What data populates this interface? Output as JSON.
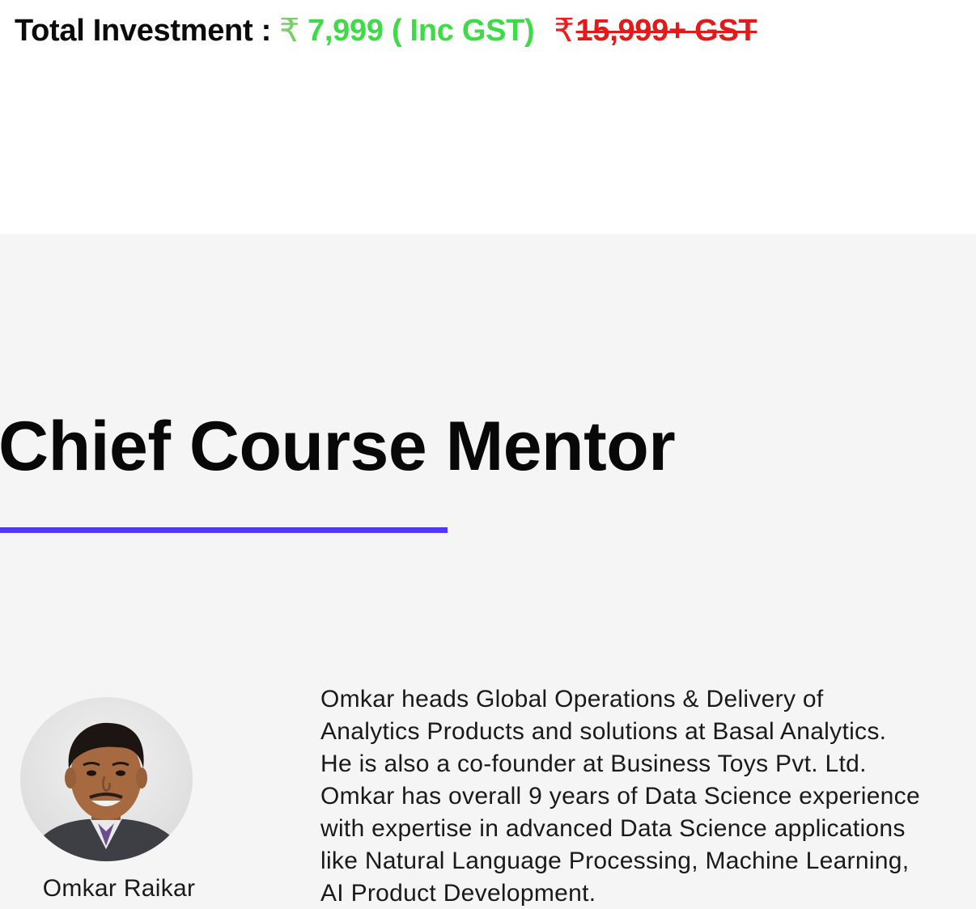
{
  "pricing": {
    "label": "Total Investment :",
    "currency_symbol": "₹",
    "current_price": "7,999 ( Inc GST)",
    "original_price": "15,999+ GST",
    "colors": {
      "label": "#0b0b0b",
      "current": "#3ddc47",
      "original": "#e21a1a"
    }
  },
  "mentor_section": {
    "heading": "Chief Course Mentor",
    "accent_color": "#4f39f6",
    "mentor": {
      "name": "Omkar Raikar",
      "photo_icon": "mentor-photo",
      "bio_lines": [
        "Omkar heads Global Operations & Delivery of",
        "Analytics Products and solutions at Basal Analytics.",
        "He is also a co-founder at Business Toys Pvt. Ltd.",
        "Omkar has overall 9 years of Data Science experience",
        "with expertise in advanced Data Science applications",
        "like Natural Language Processing, Machine Learning,",
        "AI Product Development."
      ]
    }
  }
}
